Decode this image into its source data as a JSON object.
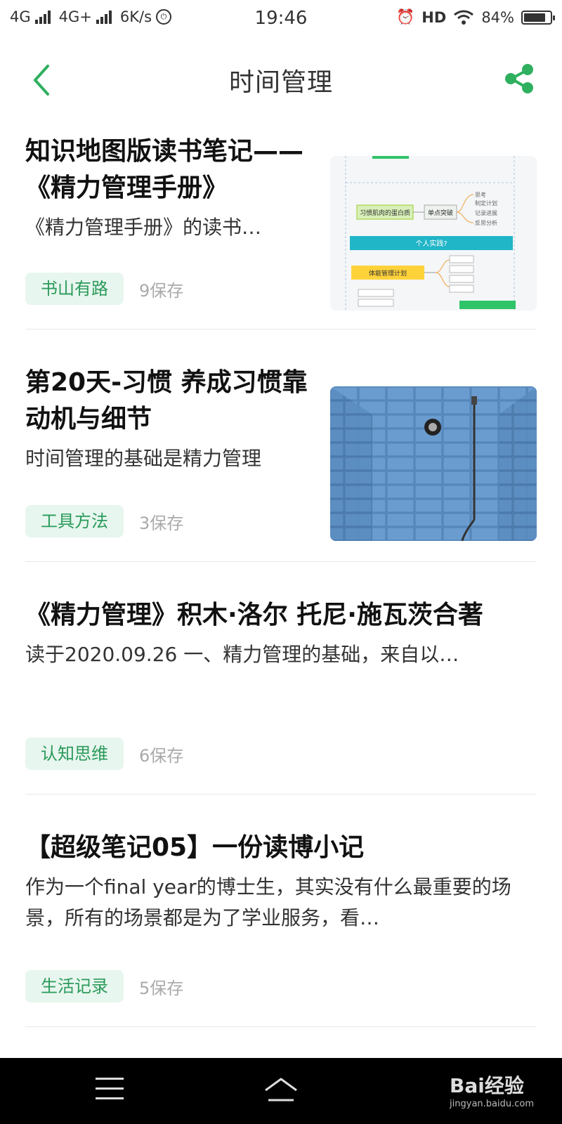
{
  "status_bar": {
    "network1": "4G",
    "network2": "4G+",
    "speed": "6K/s",
    "time": "19:46",
    "hd": "HD",
    "battery_percent": "84%",
    "battery_level": 0.84
  },
  "header": {
    "title": "时间管理",
    "accent_color": "#2fb05f"
  },
  "cards": [
    {
      "title": "知识地图版读书笔记——《精力管理手册》",
      "summary": "《精力管理手册》的读书…",
      "tag": "书山有路",
      "saves": "9保存",
      "thumbnail": "mind-map",
      "thumb_labels": [
        "习惯肌肉的蛋白质",
        "单点突破",
        "个人实践?",
        "体能管理计划",
        "思考",
        "制定计划",
        "记录进展",
        "反思分析"
      ]
    },
    {
      "title": "第20天-习惯 养成习惯靠动机与细节",
      "summary": "时间管理的基础是精力管理",
      "tag": "工具方法",
      "saves": "3保存",
      "thumbnail": "blue-tile-shower"
    },
    {
      "title": "《精力管理》积木·洛尔 托尼·施瓦茨合著",
      "summary": "读于2020.09.26 一、精力管理的基础，来自以…",
      "tag": "认知思维",
      "saves": "6保存"
    },
    {
      "title": "【超级笔记05】一份读博小记",
      "summary": "作为一个final year的博士生，其实没有什么最重要的场景，所有的场景都是为了学业服务，看…",
      "tag": "生活记录",
      "saves": "5保存"
    }
  ],
  "watermark": {
    "brand": "Bai经验",
    "url": "jingyan.baidu.com"
  }
}
